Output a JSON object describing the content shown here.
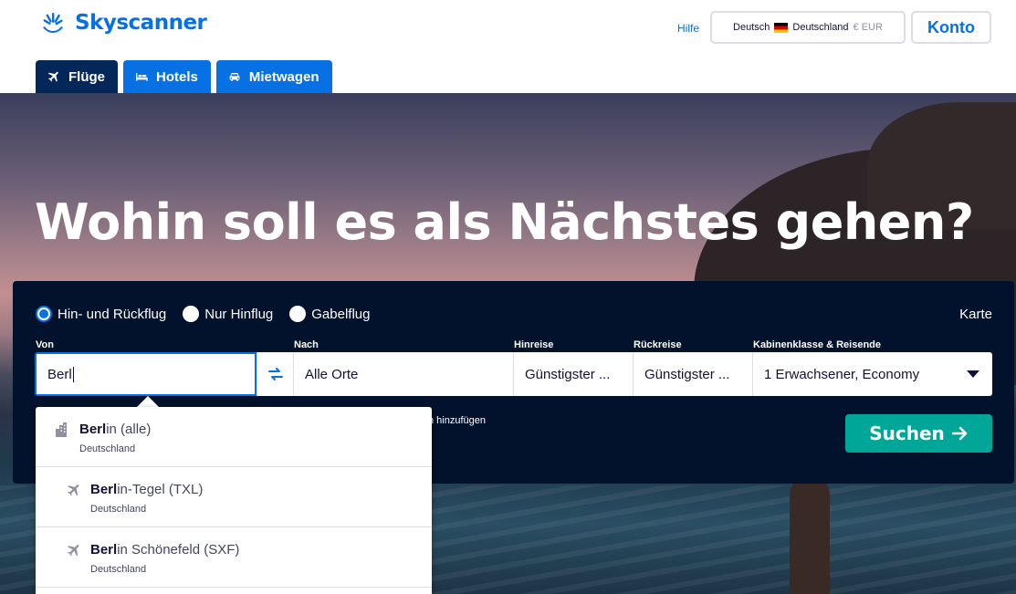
{
  "brand": {
    "name": "Skyscanner",
    "color": "#0770e3"
  },
  "header": {
    "help_label": "Hilfe",
    "locale": {
      "language": "Deutsch",
      "country": "Deutschland",
      "currency": "€ EUR"
    },
    "account_label": "Konto"
  },
  "tabs": [
    {
      "label": "Flüge",
      "icon": "plane-icon",
      "active": true
    },
    {
      "label": "Hotels",
      "icon": "bed-icon",
      "active": false
    },
    {
      "label": "Mietwagen",
      "icon": "car-icon",
      "active": false
    }
  ],
  "hero": {
    "headline": "Wohin soll es als Nächstes gehen?"
  },
  "search": {
    "trip_types": [
      {
        "label": "Hin- und Rückflug",
        "selected": true
      },
      {
        "label": "Nur Hinflug",
        "selected": false
      },
      {
        "label": "Gabelflug",
        "selected": false
      }
    ],
    "map_label": "Karte",
    "from": {
      "label": "Von",
      "value": "Berl"
    },
    "to": {
      "label": "Nach",
      "value": "Alle Orte"
    },
    "depart": {
      "label": "Hinreise",
      "value": "Günstigster ..."
    },
    "return": {
      "label": "Rückreise",
      "value": "Günstigster ..."
    },
    "cabin": {
      "label": "Kabinenklasse & Reisende",
      "value": "1 Erwachsener, Economy"
    },
    "add_nearby_text": "n hinzufügen",
    "submit_label": "Suchen",
    "submit_color": "#00a698"
  },
  "suggestions": [
    {
      "match": "Berl",
      "rest": "in (alle)",
      "country": "Deutschland",
      "icon": "city-icon"
    },
    {
      "match": "Berl",
      "rest": "in-Tegel (TXL)",
      "country": "Deutschland",
      "icon": "airport-plane-icon"
    },
    {
      "match": "Berl",
      "rest": "in Schönefeld (SXF)",
      "country": "Deutschland",
      "icon": "airport-plane-icon"
    }
  ]
}
